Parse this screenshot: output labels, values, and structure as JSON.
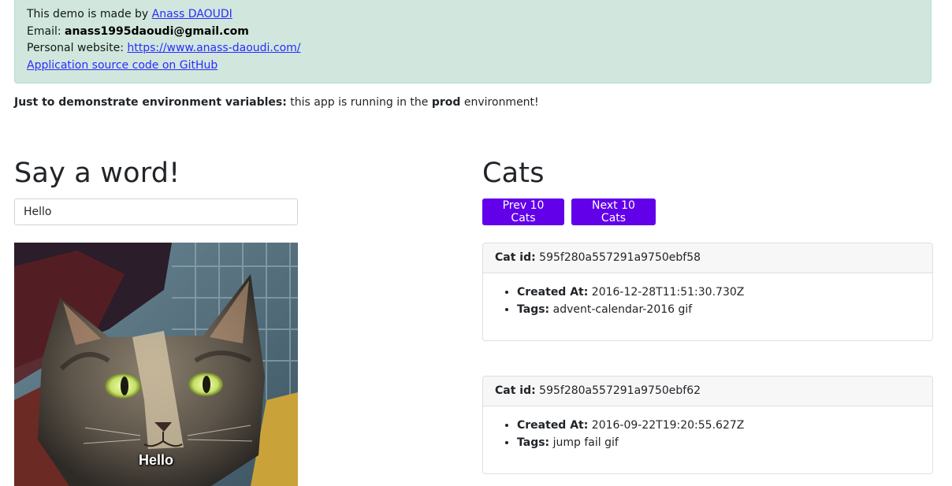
{
  "info": {
    "made_by_prefix": "This demo is made by ",
    "author_name": "Anass DAOUDI",
    "email_label": "Email: ",
    "email": "anass1995daoudi@gmail.com",
    "website_label": "Personal website: ",
    "website_url": "https://www.anass-daoudi.com/",
    "source_link": "Application source code on GitHub"
  },
  "environment": {
    "label": "Just to demonstrate environment variables:",
    "text_before": " this app is running in the ",
    "env_name": "prod",
    "text_after": " environment!"
  },
  "word_section": {
    "title": "Say a word!",
    "input_value": "Hello",
    "image_caption": "Hello"
  },
  "cats_section": {
    "title": "Cats",
    "prev_button": "Prev 10 Cats",
    "next_button": "Next 10 Cats",
    "cat_id_label": "Cat id:",
    "created_label": "Created At:",
    "tags_label": "Tags:",
    "cats": [
      {
        "id": "595f280a557291a9750ebf58",
        "created_at": "2016-12-28T11:51:30.730Z",
        "tags": "advent-calendar-2016 gif"
      },
      {
        "id": "595f280a557291a9750ebf62",
        "created_at": "2016-09-22T19:20:55.627Z",
        "tags": "jump fail gif"
      }
    ]
  },
  "colors": {
    "alert_background": "#d1e7dd",
    "button_accent": "#6200ea",
    "link": "#2b2bff"
  }
}
